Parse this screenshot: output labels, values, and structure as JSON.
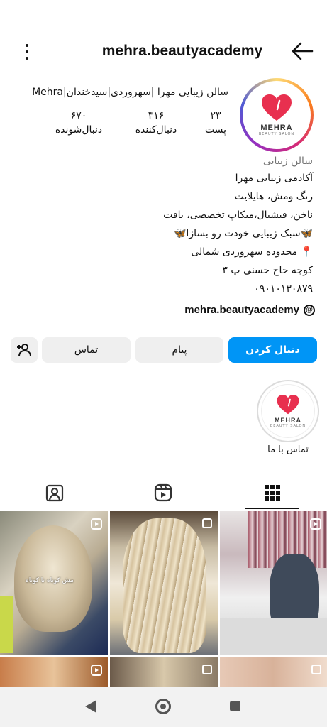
{
  "header": {
    "username": "mehra.beautyacademy"
  },
  "profile": {
    "avatar_brand": "MEHRA",
    "avatar_brand_sub": "BEAUTY SALON",
    "full_name": "سالن زیبایی مهرا |سهروردی|سیدخندان|Mehra",
    "stats": {
      "posts_value": "۲۳",
      "posts_label": "پست",
      "following_value": "۳۱۶",
      "following_label": "دنبال‌کننده",
      "followers_value": "۶۷۰",
      "followers_label": "دنبال‌شونده"
    },
    "category": "سالن زیبایی",
    "bio_lines": [
      "آکادمی زیبایی مهرا",
      "رنگ ومش، هایلایت",
      "ناخن، فیشیال،میکاپ تخصصی، بافت",
      "🦋سبک زیبایی خودت رو بسازا🦋",
      "📍 محدوده سهروردی شمالی",
      "کوچه حاج حسنی پ ۳",
      "۰۹۰۱۰۱۳۰۸۷۹"
    ],
    "threads_handle": "mehra.beautyacademy"
  },
  "actions": {
    "follow_label": "دنبال کردن",
    "message_label": "پیام",
    "contact_label": "تماس"
  },
  "highlight": {
    "brand": "MEHRA",
    "brand_sub": "BEAUTY SALON",
    "label": "تماس با ما"
  },
  "tabs": [
    "tagged-icon",
    "reels-icon",
    "grid-icon"
  ],
  "grid": {
    "post1_overlay": "مش کوتاه تا کوتاه"
  },
  "colors": {
    "accent": "#0095f6",
    "brand_heart": "#e8304f"
  }
}
